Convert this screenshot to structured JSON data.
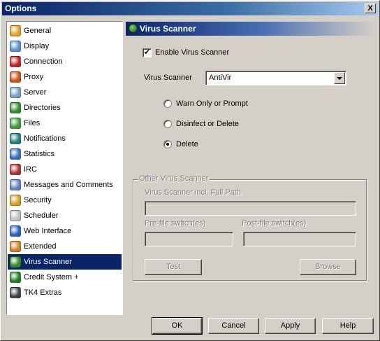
{
  "window": {
    "title": "Options",
    "close_label": "X"
  },
  "sidebar": {
    "items": [
      {
        "label": "General",
        "icon": "gear-icon",
        "color": "#e0a020"
      },
      {
        "label": "Display",
        "icon": "monitor-icon",
        "color": "#5a8fd0"
      },
      {
        "label": "Connection",
        "icon": "plug-icon",
        "color": "#c02020"
      },
      {
        "label": "Proxy",
        "icon": "proxy-icon",
        "color": "#d05010"
      },
      {
        "label": "Server",
        "icon": "server-icon",
        "color": "#7a9cc8"
      },
      {
        "label": "Directories",
        "icon": "folder-icon",
        "color": "#2e8b2e"
      },
      {
        "label": "Files",
        "icon": "files-icon",
        "color": "#3a9a3a"
      },
      {
        "label": "Notifications",
        "icon": "notification-icon",
        "color": "#208080"
      },
      {
        "label": "Statistics",
        "icon": "statistics-icon",
        "color": "#3070c0"
      },
      {
        "label": "IRC",
        "icon": "irc-icon",
        "color": "#b03030"
      },
      {
        "label": "Messages and Comments",
        "icon": "messages-icon",
        "color": "#6080c0"
      },
      {
        "label": "Security",
        "icon": "lock-icon",
        "color": "#d0a020"
      },
      {
        "label": "Scheduler",
        "icon": "calendar-icon",
        "color": "#c0c0c0"
      },
      {
        "label": "Web Interface",
        "icon": "globe-icon",
        "color": "#2060c0"
      },
      {
        "label": "Extended",
        "icon": "extended-icon",
        "color": "#d08020"
      },
      {
        "label": "Virus Scanner",
        "icon": "virus-scanner-icon",
        "color": "#2f8f1f",
        "selected": true
      },
      {
        "label": "Credit System +",
        "icon": "credit-icon",
        "color": "#208020"
      },
      {
        "label": "TK4 Extras",
        "icon": "extras-icon",
        "color": "#404040"
      }
    ]
  },
  "panel": {
    "title": "Virus Scanner",
    "enable_label": "Enable Virus Scanner",
    "enable_checked": true,
    "scanner_label": "Virus Scanner",
    "scanner_value": "AntiVir",
    "radios": [
      {
        "label": "Warn Only or Prompt",
        "checked": false
      },
      {
        "label": "Disinfect or Delete",
        "checked": false
      },
      {
        "label": "Delete",
        "checked": true
      }
    ],
    "other": {
      "legend": "Other Virus Scanner",
      "path_label": "Virus Scanner incl. Full Path",
      "path_value": "",
      "pre_label": "Pre-file switch(es)",
      "pre_value": "",
      "post_label": "Post-file switch(es)",
      "post_value": "",
      "test_label": "Test",
      "browse_label": "Browse"
    }
  },
  "buttons": {
    "ok": "OK",
    "cancel": "Cancel",
    "apply": "Apply",
    "help": "Help"
  }
}
